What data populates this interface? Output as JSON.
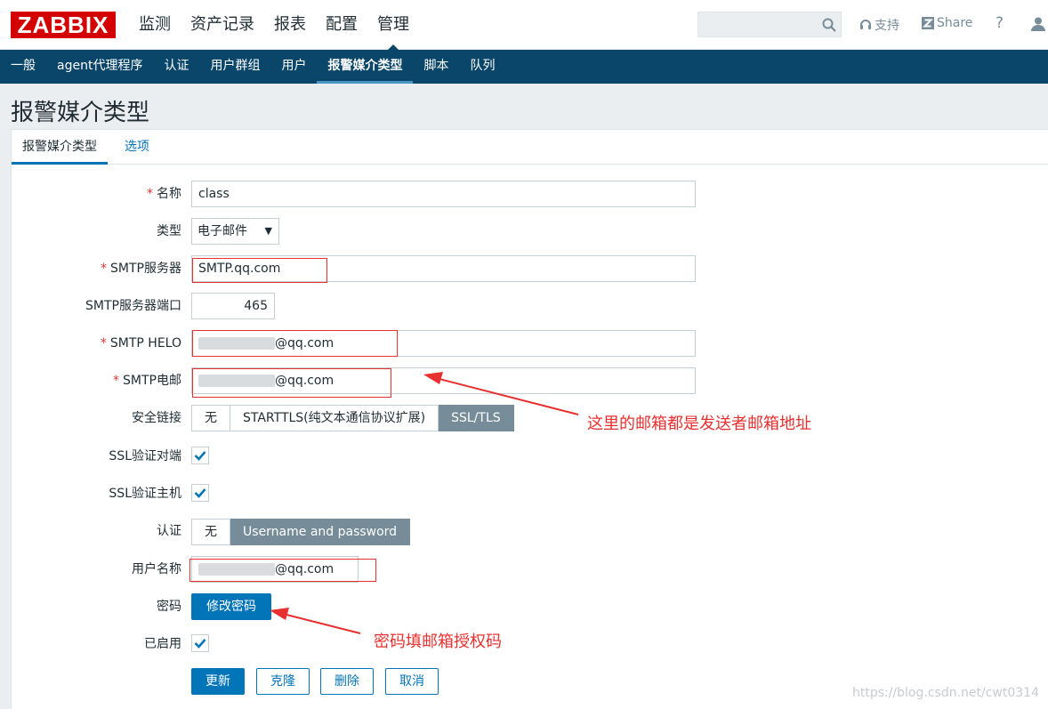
{
  "logo": "ZABBIX",
  "main_nav": [
    "监测",
    "资产记录",
    "报表",
    "配置",
    "管理"
  ],
  "main_nav_active": "管理",
  "topbar": {
    "search_value": "",
    "support": "支持",
    "share": "Share",
    "help": "?"
  },
  "sub_nav": [
    "一般",
    "agent代理程序",
    "认证",
    "用户群组",
    "用户",
    "报警媒介类型",
    "脚本",
    "队列"
  ],
  "sub_nav_active": "报警媒介类型",
  "page_title": "报警媒介类型",
  "tabs": [
    "报警媒介类型",
    "选项"
  ],
  "form": {
    "name_label": "名称",
    "name_value": "class",
    "type_label": "类型",
    "type_value": "电子邮件",
    "smtp_server_label": "SMTP服务器",
    "smtp_server_value": "SMTP.qq.com",
    "smtp_port_label": "SMTP服务器端口",
    "smtp_port_value": "465",
    "smtp_helo_label": "SMTP HELO",
    "smtp_helo_value": "@qq.com",
    "smtp_email_label": "SMTP电邮",
    "smtp_email_value": "@qq.com",
    "security_label": "安全链接",
    "security_options": [
      "无",
      "STARTTLS(纯文本通信协议扩展)",
      "SSL/TLS"
    ],
    "security_selected": "SSL/TLS",
    "ssl_verify_peer_label": "SSL验证对端",
    "ssl_verify_peer": true,
    "ssl_verify_host_label": "SSL验证主机",
    "ssl_verify_host": true,
    "auth_label": "认证",
    "auth_options": [
      "无",
      "Username and password"
    ],
    "auth_selected": "Username and password",
    "username_label": "用户名称",
    "username_value": "@qq.com",
    "password_label": "密码",
    "change_password_button": "修改密码",
    "enabled_label": "已启用",
    "enabled": true
  },
  "buttons": {
    "update": "更新",
    "clone": "克隆",
    "delete": "删除",
    "cancel": "取消"
  },
  "annotations": {
    "sender_note": "这里的邮箱都是发送者邮箱地址",
    "password_note": "密码填邮箱授权码"
  },
  "watermark": "https://blog.csdn.net/cwt0314",
  "colors": {
    "brand_red": "#d40000",
    "subnav_bg": "#0a466a",
    "accent_blue": "#0275b8",
    "annotation_red": "#e83030",
    "selected_grey": "#768d99"
  }
}
